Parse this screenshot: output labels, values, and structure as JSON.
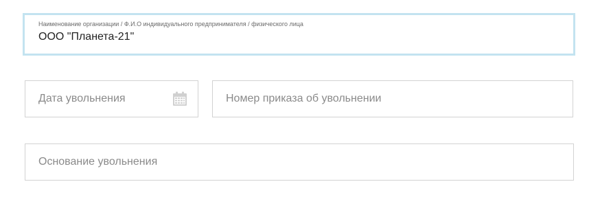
{
  "organization": {
    "label": "Наименование организации / Ф.И.О индивидуального предпринимателя / физического лица",
    "value": "ООО \"Планета-21\""
  },
  "dismissal_date": {
    "placeholder": "Дата увольнения",
    "icon": "calendar-icon"
  },
  "dismissal_order": {
    "placeholder": "Номер приказа об увольнении"
  },
  "dismissal_reason": {
    "placeholder": "Основание увольнения"
  },
  "colors": {
    "focus_border": "#c3e3f0",
    "field_border": "#d2d2d2",
    "placeholder_text": "#8a8a8a",
    "value_text": "#222222",
    "icon": "#d0d0d0"
  }
}
